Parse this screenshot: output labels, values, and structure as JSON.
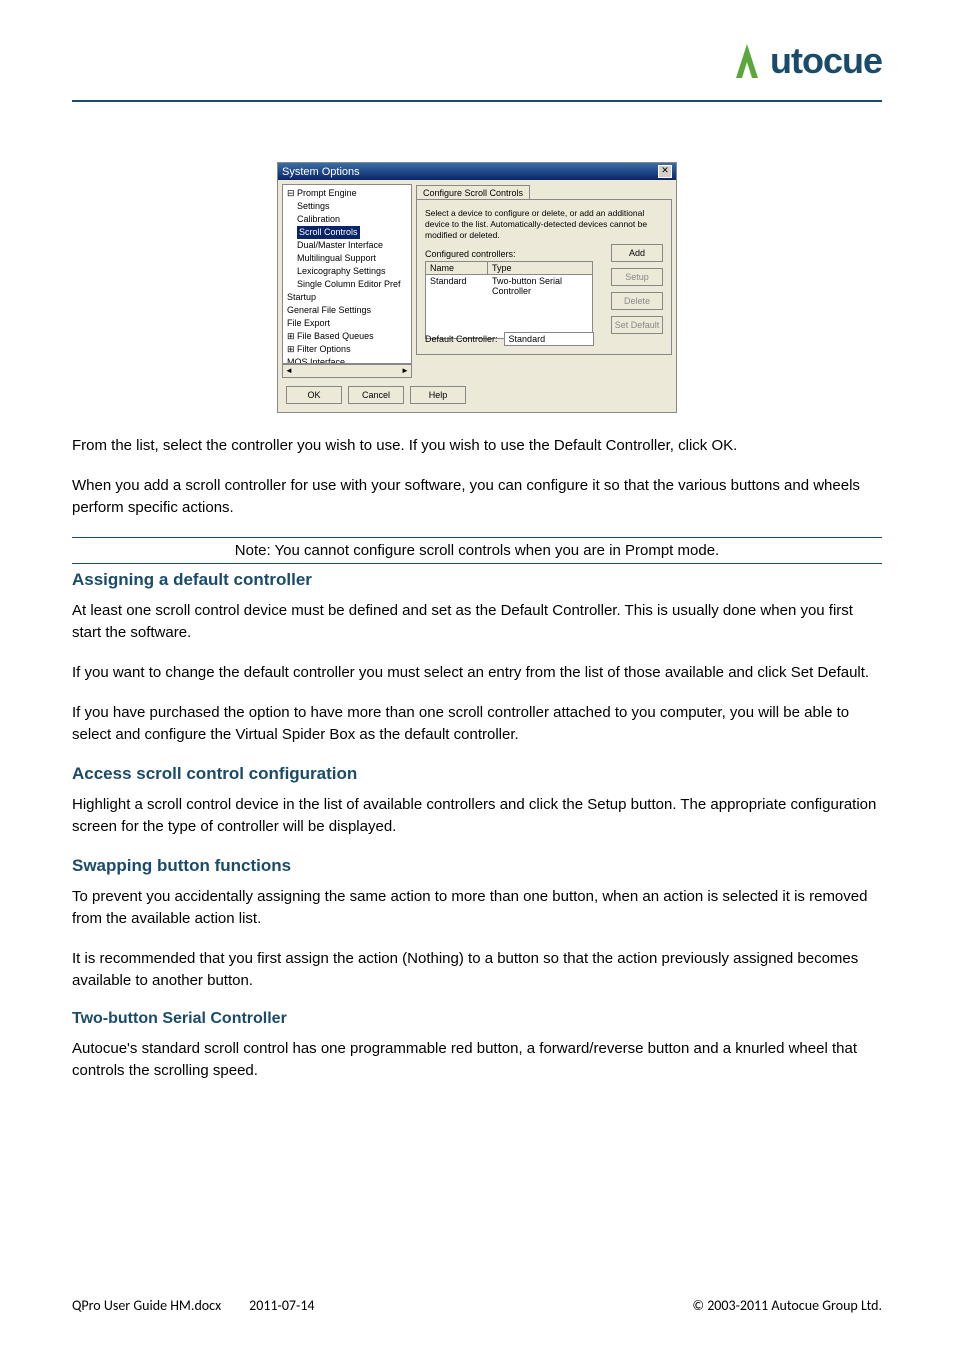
{
  "logo_text": "utocue",
  "dialog": {
    "title": "System Options",
    "tree": [
      {
        "label": "Prompt Engine",
        "indent": 0,
        "prefix": "⊟"
      },
      {
        "label": "Settings",
        "indent": 1
      },
      {
        "label": "Calibration",
        "indent": 1
      },
      {
        "label": "Scroll Controls",
        "indent": 1,
        "selected": true
      },
      {
        "label": "Dual/Master Interface",
        "indent": 1
      },
      {
        "label": "Multilingual Support",
        "indent": 1
      },
      {
        "label": "Lexicography Settings",
        "indent": 1
      },
      {
        "label": "Single Column Editor Pref",
        "indent": 1
      },
      {
        "label": "Startup",
        "indent": 0
      },
      {
        "label": "General File Settings",
        "indent": 0
      },
      {
        "label": "File Export",
        "indent": 0
      },
      {
        "label": "File Based Queues",
        "indent": 0,
        "prefix": "⊞"
      },
      {
        "label": "Filter Options",
        "indent": 0,
        "prefix": "⊞"
      },
      {
        "label": "MOS Interface",
        "indent": 0
      }
    ],
    "tab_label": "Configure Scroll Controls",
    "instructions": "Select a device to configure or delete, or add an additional device to the list. Automatically-detected devices cannot be modified or deleted.",
    "list_label": "Configured controllers:",
    "columns": {
      "name": "Name",
      "type": "Type"
    },
    "row": {
      "name": "Standard",
      "type": "Two-button Serial Controller"
    },
    "buttons": {
      "add": "Add",
      "setup": "Setup",
      "delete": "Delete",
      "set_default": "Set Default"
    },
    "default_label": "Default Controller:",
    "default_value": "Standard",
    "footer_buttons": {
      "ok": "OK",
      "cancel": "Cancel",
      "help": "Help"
    }
  },
  "body": {
    "p1": "From the list, select the controller you wish to use.  If you wish to use the Default Controller, click OK.",
    "p2": "When you add a scroll controller for use with your software, you can configure it so that the various buttons and wheels perform specific actions.",
    "note": "Note: You cannot configure scroll controls when you are in Prompt mode.",
    "h_assign": "Assigning a default controller",
    "p3": "At least one scroll control device must be defined and set as the Default Controller. This is usually done when you first start the software.",
    "p4": "If you want to change the default controller you must select an entry from the list of those available and click Set Default.",
    "p5": "If you have purchased the option to have more than one scroll controller attached to you computer, you will be able to select and configure the Virtual Spider Box as the default controller.",
    "h_access": "Access scroll control configuration",
    "p6": "Highlight a scroll control device in the list of available controllers and click the Setup button. The appropriate configuration screen for the type of controller will be displayed.",
    "h_swap": "Swapping button functions",
    "p7": "To prevent you accidentally assigning the same action to more than one button, when an action is selected it is removed from the available action list.",
    "p8": "It is recommended that you first assign the action (Nothing) to a button so that the action previously assigned becomes available to another button.",
    "h_two": "Two-button Serial Controller",
    "p9": "Autocue's standard scroll control has one programmable red button, a forward/reverse button and a knurled wheel that controls the scrolling speed."
  },
  "footer": {
    "doc": "QPro User Guide HM.docx",
    "date": "2011-07-14",
    "copyright": "© 2003-2011 Autocue Group Ltd."
  }
}
